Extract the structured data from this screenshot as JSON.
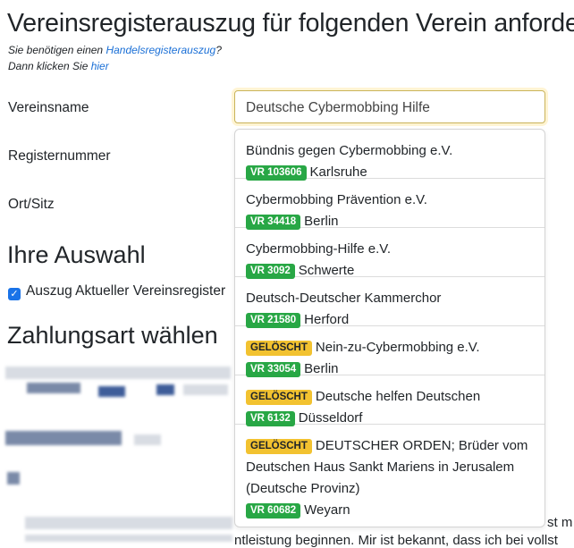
{
  "page_title": "Vereinsregisterauszug für folgenden Verein anfordern",
  "hint1_prefix": "Sie benötigen einen ",
  "hint1_link": "Handelsregisterauszug",
  "hint1_suffix": "?",
  "hint2_prefix": "Dann klicken Sie ",
  "hint2_link": "hier",
  "form": {
    "name_label": "Vereinsname",
    "name_value": "Deutsche Cybermobbing Hilfe",
    "register_label": "Registernummer",
    "ort_label": "Ort/Sitz"
  },
  "selection": {
    "heading": "Ihre Auswahl",
    "checkbox_label": "Auszug Aktueller Vereinsregister"
  },
  "payment": {
    "heading": "Zahlungsart wählen"
  },
  "background_fragments": [
    "st m",
    "ntleistung beginnen. Mir ist bekannt, dass ich bei vollst"
  ],
  "dropdown": {
    "options": [
      {
        "name": "Bündnis gegen Cybermobbing e.V.",
        "reg": "VR 103606",
        "city": "Karlsruhe",
        "deleted": false
      },
      {
        "name": "Cybermobbing Prävention e.V.",
        "reg": "VR 34418",
        "city": "Berlin",
        "deleted": false
      },
      {
        "name": "Cybermobbing-Hilfe e.V.",
        "reg": "VR 3092",
        "city": "Schwerte",
        "deleted": false
      },
      {
        "name": "Deutsch-Deutscher Kammerchor",
        "reg": "VR 21580",
        "city": "Herford",
        "deleted": false
      },
      {
        "name": "Nein-zu-Cybermobbing e.V.",
        "reg": "VR 33054",
        "city": "Berlin",
        "deleted": true
      },
      {
        "name": "Deutsche helfen Deutschen",
        "reg": "VR 6132",
        "city": "Düsseldorf",
        "deleted": true
      },
      {
        "name": "DEUTSCHER ORDEN; Brüder vom Deutschen Haus Sankt Mariens in Jerusalem (Deutsche Provinz)",
        "reg": "VR 60682",
        "city": "Weyarn",
        "deleted": true
      }
    ],
    "deleted_badge": "GELÖSCHT"
  },
  "colors": {
    "link": "#1a6fd6",
    "badge_green": "#28a745",
    "badge_yellow": "#f2c230",
    "checkbox": "#1a73e8"
  }
}
